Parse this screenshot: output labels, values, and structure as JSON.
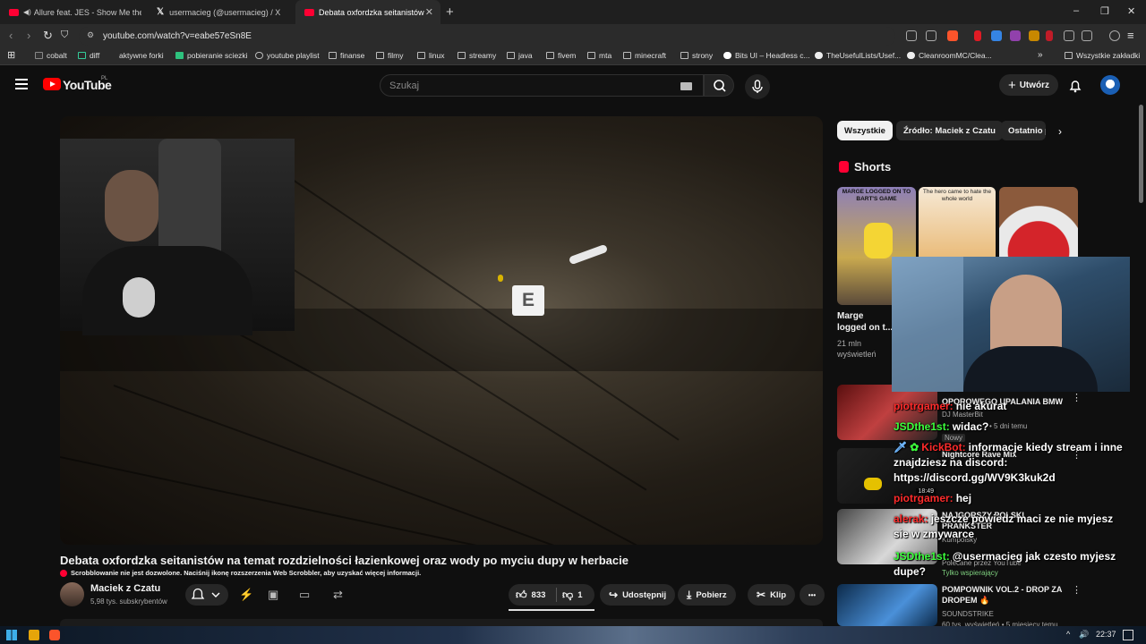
{
  "browser": {
    "tabs": [
      {
        "title": "Allure feat. JES - Show Me the W",
        "active": false,
        "favicon": "youtube-audio"
      },
      {
        "title": "usermacieg (@usermacieg) / X",
        "active": false,
        "favicon": "x-logo"
      },
      {
        "title": "Debata oxfordzka seitanistów n",
        "active": true,
        "favicon": "youtube"
      }
    ],
    "new_tab_label": "+",
    "window_controls": [
      "–",
      "❐",
      "✕"
    ],
    "url": "youtube.com/watch?v=eabe57eSn8E",
    "bookmarks": [
      {
        "label": "cobalt"
      },
      {
        "label": "diff"
      },
      {
        "label": "aktywne forki"
      },
      {
        "label": "pobieranie sciezki"
      },
      {
        "label": "youtube playlist"
      },
      {
        "label": "finanse"
      },
      {
        "label": "filmy"
      },
      {
        "label": "linux"
      },
      {
        "label": "streamy"
      },
      {
        "label": "java"
      },
      {
        "label": "fivem"
      },
      {
        "label": "mta"
      },
      {
        "label": "minecraft"
      },
      {
        "label": "strony"
      },
      {
        "label": "Bits UI – Headless c..."
      },
      {
        "label": "TheUsefulLists/Usef..."
      },
      {
        "label": "CleanroomMC/Clea..."
      }
    ],
    "more_bookmarks": "»",
    "all_bookmarks": "Wszystkie zakładki"
  },
  "youtube": {
    "logo_text": "YouTube",
    "region": "PL",
    "search_placeholder": "Szukaj",
    "create_label": "Utwórz",
    "video": {
      "overlay_key": "E",
      "title": "Debata oxfordzka seitanistów na temat rozdzielności łazienkowej oraz wody po myciu dupy w herbacie",
      "scrobbler_notice": "Scrobblowanie nie jest dozwolone. Naciśnij ikonę rozszerzenia Web Scrobbler, aby uzyskać więcej informacji.",
      "channel_name": "Maciek z Czatu",
      "channel_subs": "5,98 tys. subskrybentów",
      "likes": "833",
      "dislikes": "1",
      "share_label": "Udostępnij",
      "download_label": "Pobierz",
      "clip_label": "Klip",
      "more_label": "•••"
    },
    "sidebar": {
      "chips": [
        "Wszystkie",
        "Źródło: Maciek z Czatu",
        "Ostatnio p"
      ],
      "shorts_heading": "Shorts",
      "shorts": [
        {
          "thumb_text": "MARGE LOGGED ON TO BART'S GAME",
          "title_line1": "Marge",
          "title_line2": "logged on t...",
          "views_line1": "21 mln",
          "views_line2": "wyświetleń"
        },
        {
          "thumb_text": "The hero came to hate the whole world"
        },
        {
          "thumb_text": ""
        }
      ],
      "videos": [
        {
          "title": "OPOROWEGO UPALANIA BMW",
          "channel": "DJ MasterBit",
          "meta": "• 5 dni temu",
          "badge": "Nowy"
        },
        {
          "title": "Nightcore Rave Mix",
          "channel": "",
          "meta": "",
          "duration": "18:49"
        },
        {
          "title": "NAJGORSZY POLSKI PRANKSTER",
          "channel": "Kumpolsky",
          "meta": "Polecane przez YouTube",
          "badge": "Tylko wspierający"
        },
        {
          "title": "POMPOWNIK VOL.2 - DROP ZA DROPEM 🔥",
          "channel": "SOUNDSTRIKE",
          "meta": "60 tys. wyświetleń • 5 miesięcy temu"
        }
      ],
      "menu_dots": "⋮"
    }
  },
  "chat": [
    {
      "user": "piotrgamer:",
      "user_color": "#ff2b2b",
      "text": "nie akurat"
    },
    {
      "user": "JSDthe1st:",
      "user_color": "#3cff3c",
      "text": "widac?"
    },
    {
      "user": "KickBot:",
      "user_color": "#ff2b2b",
      "text": "informacje kiedy stream i inne"
    },
    {
      "user": "",
      "user_color": "#ffffff",
      "text": "znajdziesz na discord:"
    },
    {
      "user": "",
      "user_color": "#ffffff",
      "text": "https://discord.gg/WV9K3kuk2d"
    },
    {
      "user": "piotrgamer:",
      "user_color": "#ff2b2b",
      "text": "hej"
    },
    {
      "user": "alerak:",
      "user_color": "#ff2b2b",
      "text": "jeszcze powiedz maci ze nie myjesz"
    },
    {
      "user": "",
      "user_color": "#ffffff",
      "text": "sie w zmywarce"
    },
    {
      "user": "JSDthe1st:",
      "user_color": "#3cff3c",
      "text": "@usermacieg jak czesto myjesz"
    },
    {
      "user": "",
      "user_color": "#ffffff",
      "text": "dupe?"
    }
  ],
  "taskbar": {
    "time": "22:37",
    "tray_icons": [
      "^",
      "🔊"
    ]
  },
  "colors": {
    "bg": "#0f0f0f",
    "accent_red": "#ff0000",
    "chip_selected": "#f1f1f1",
    "chat_green": "#3cff3c",
    "chat_red": "#ff2b2b"
  }
}
